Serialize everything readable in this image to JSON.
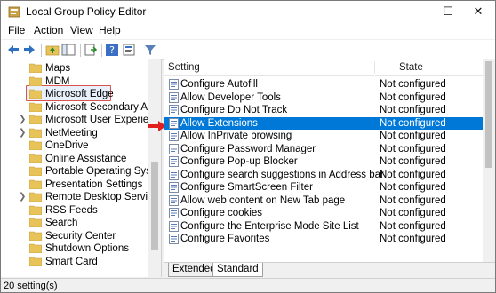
{
  "window": {
    "title": "Local Group Policy Editor",
    "minimize": "—",
    "maximize": "☐",
    "close": "✕"
  },
  "menu": {
    "items": [
      "File",
      "Action",
      "View",
      "Help"
    ]
  },
  "tree": {
    "items": [
      {
        "label": "Maps",
        "expandable": false
      },
      {
        "label": "MDM",
        "expandable": false
      },
      {
        "label": "Microsoft Edge",
        "expandable": false,
        "selected": true
      },
      {
        "label": "Microsoft Secondary Authe",
        "expandable": false
      },
      {
        "label": "Microsoft User Experience V",
        "expandable": true
      },
      {
        "label": "NetMeeting",
        "expandable": true
      },
      {
        "label": "OneDrive",
        "expandable": false
      },
      {
        "label": "Online Assistance",
        "expandable": false
      },
      {
        "label": "Portable Operating System",
        "expandable": false
      },
      {
        "label": "Presentation Settings",
        "expandable": false
      },
      {
        "label": "Remote Desktop Services",
        "expandable": true
      },
      {
        "label": "RSS Feeds",
        "expandable": false
      },
      {
        "label": "Search",
        "expandable": false
      },
      {
        "label": "Security Center",
        "expandable": false
      },
      {
        "label": "Shutdown Options",
        "expandable": false
      },
      {
        "label": "Smart Card",
        "expandable": false
      }
    ]
  },
  "list": {
    "columns": {
      "setting": "Setting",
      "state": "State"
    },
    "rows": [
      {
        "name": "Configure Autofill",
        "state": "Not configured"
      },
      {
        "name": "Allow Developer Tools",
        "state": "Not configured"
      },
      {
        "name": "Configure Do Not Track",
        "state": "Not configured"
      },
      {
        "name": "Allow Extensions",
        "state": "Not configured",
        "selected": true
      },
      {
        "name": "Allow InPrivate browsing",
        "state": "Not configured"
      },
      {
        "name": "Configure Password Manager",
        "state": "Not configured"
      },
      {
        "name": "Configure Pop-up Blocker",
        "state": "Not configured"
      },
      {
        "name": "Configure search suggestions in Address bar",
        "state": "Not configured"
      },
      {
        "name": "Configure SmartScreen Filter",
        "state": "Not configured"
      },
      {
        "name": "Allow web content on New Tab page",
        "state": "Not configured"
      },
      {
        "name": "Configure cookies",
        "state": "Not configured"
      },
      {
        "name": "Configure the Enterprise Mode Site List",
        "state": "Not configured"
      },
      {
        "name": "Configure Favorites",
        "state": "Not configured"
      }
    ]
  },
  "tabs": {
    "extended": "Extended",
    "standard": "Standard"
  },
  "status": {
    "text": "20 setting(s)"
  },
  "colors": {
    "selection": "#0078d7",
    "highlight_border": "#d9534f",
    "arrow": "#e02020",
    "folder": "#e8c35a"
  }
}
